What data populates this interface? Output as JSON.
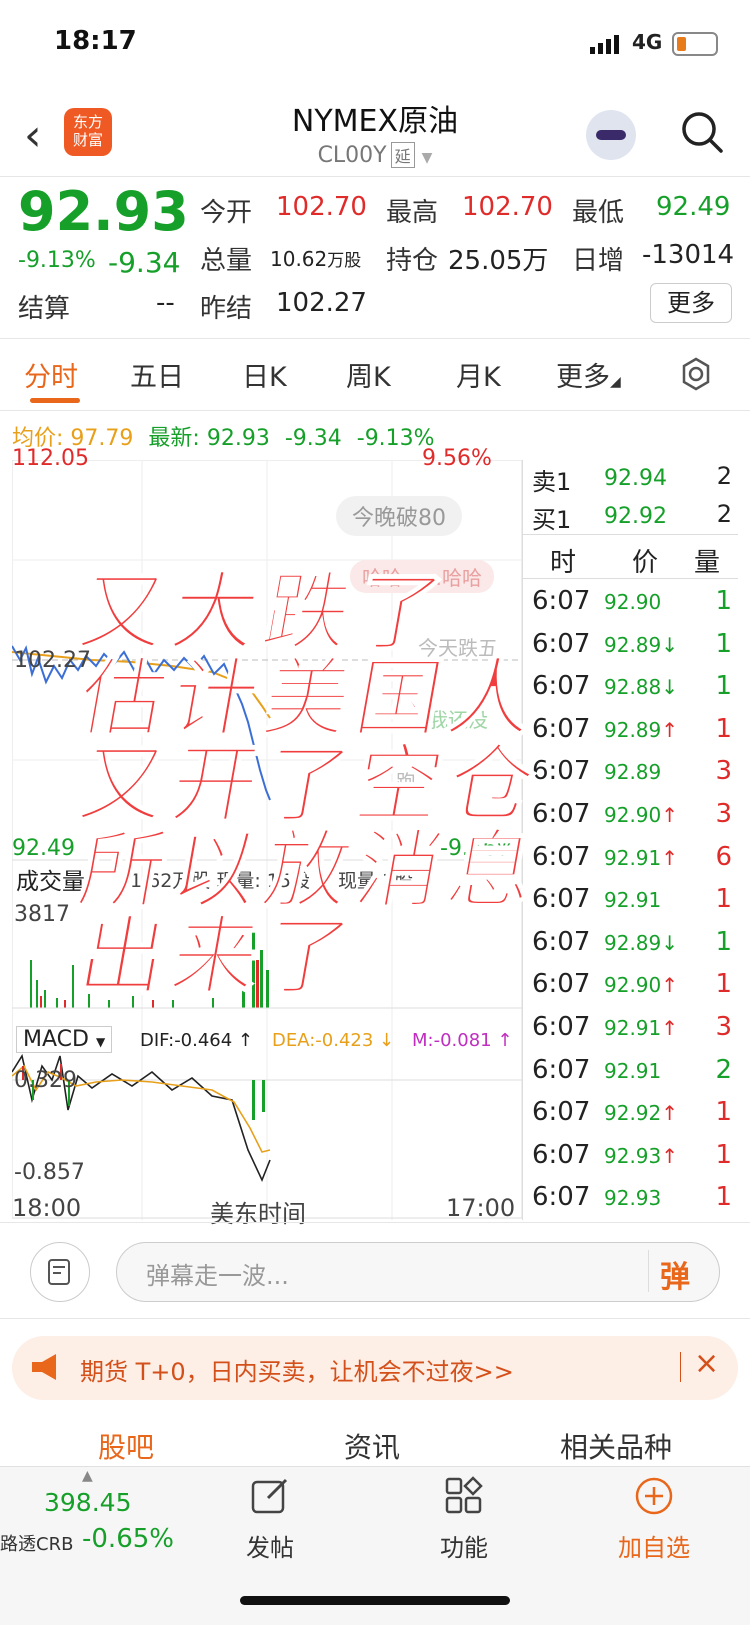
{
  "status": {
    "time": "18:17",
    "network": "4G"
  },
  "header": {
    "title": "NYMEX原油",
    "code": "CL00Y",
    "tag": "延"
  },
  "quote": {
    "price": "92.93",
    "change_pct": "-9.13%",
    "change": "-9.34",
    "open_label": "今开",
    "open": "102.70",
    "high_label": "最高",
    "high": "102.70",
    "low_label": "最低",
    "low": "92.49",
    "volume_label": "总量",
    "volume": "10.62",
    "volume_unit": "万股",
    "position_label": "持仓",
    "position": "25.05万",
    "daily_inc_label": "日增",
    "daily_inc": "-13014",
    "settle_label": "结算",
    "settle": "--",
    "prev_settle_label": "昨结",
    "prev_settle": "102.27",
    "more_label": "更多"
  },
  "tabs": [
    "分时",
    "五日",
    "日K",
    "周K",
    "月K",
    "更多"
  ],
  "avgline": {
    "avg_label": "均价:",
    "avg": "97.79",
    "latest_label": "最新:",
    "latest": "92.93",
    "change": "-9.34",
    "change_pct": "-9.13%"
  },
  "chart": {
    "y_top": "112.05",
    "y_top_pct": "9.56%",
    "y_mid": "102.27",
    "y_bottom": "92.49",
    "y_bottom_pct": "-9.56%",
    "danmu": [
      "今晚破80",
      "哈哈……哈哈",
      "今天跌五",
      "我还没",
      "跑"
    ],
    "vol_label": "成交量",
    "vol_info": "1.62万股 现量: 15股 ↓ 现量 1股",
    "vol_max": "3817",
    "macd_label": "MACD",
    "dif": "DIF:-0.464 ↑",
    "dea": "DEA:-0.423 ↓",
    "m": "M:-0.081 ↑",
    "macd_top": "0.329",
    "macd_bottom": "-0.857",
    "x_start": "18:00",
    "x_mid": "美东时间",
    "x_end": "17:00"
  },
  "orderbook": {
    "sell1_label": "卖1",
    "sell1_price": "92.94",
    "sell1_vol": "2",
    "buy1_label": "买1",
    "buy1_price": "92.92",
    "buy1_vol": "2",
    "head_time": "时",
    "head_price": "价",
    "head_vol": "量",
    "trades": [
      {
        "t": "6:07",
        "p": "92.90",
        "d": "",
        "v": "1",
        "c": "green"
      },
      {
        "t": "6:07",
        "p": "92.89",
        "d": "↓",
        "v": "1",
        "c": "green"
      },
      {
        "t": "6:07",
        "p": "92.88",
        "d": "↓",
        "v": "1",
        "c": "green"
      },
      {
        "t": "6:07",
        "p": "92.89",
        "d": "↑",
        "v": "1",
        "c": "red"
      },
      {
        "t": "6:07",
        "p": "92.89",
        "d": "",
        "v": "3",
        "c": "red"
      },
      {
        "t": "6:07",
        "p": "92.90",
        "d": "↑",
        "v": "3",
        "c": "red"
      },
      {
        "t": "6:07",
        "p": "92.91",
        "d": "↑",
        "v": "6",
        "c": "red"
      },
      {
        "t": "6:07",
        "p": "92.91",
        "d": "",
        "v": "1",
        "c": "red"
      },
      {
        "t": "6:07",
        "p": "92.89",
        "d": "↓",
        "v": "1",
        "c": "green"
      },
      {
        "t": "6:07",
        "p": "92.90",
        "d": "↑",
        "v": "1",
        "c": "red"
      },
      {
        "t": "6:07",
        "p": "92.91",
        "d": "↑",
        "v": "3",
        "c": "red"
      },
      {
        "t": "6:07",
        "p": "92.91",
        "d": "",
        "v": "2",
        "c": "green"
      },
      {
        "t": "6:07",
        "p": "92.92",
        "d": "↑",
        "v": "1",
        "c": "red"
      },
      {
        "t": "6:07",
        "p": "92.93",
        "d": "↑",
        "v": "1",
        "c": "red"
      },
      {
        "t": "6:07",
        "p": "92.93",
        "d": "",
        "v": "1",
        "c": "red"
      }
    ]
  },
  "overlay": [
    "又大跌了",
    "估计美国人",
    "又开了空仓",
    "所以放消息",
    "出来了"
  ],
  "comment": {
    "placeholder": "弹幕走一波...",
    "send": "弹"
  },
  "banner": {
    "text": "期货 T+0，日内买卖，让机会不过夜>>"
  },
  "bottom_tabs": [
    "股吧",
    "资讯",
    "相关品种"
  ],
  "bottom_nav": {
    "index_value": "398.45",
    "index_name": "路透CRB",
    "index_change": "-0.65%",
    "post": "发帖",
    "func": "功能",
    "add": "加自选"
  },
  "colors": {
    "up": "#e02b2b",
    "down": "#16a02a",
    "accent": "#e8671b"
  }
}
